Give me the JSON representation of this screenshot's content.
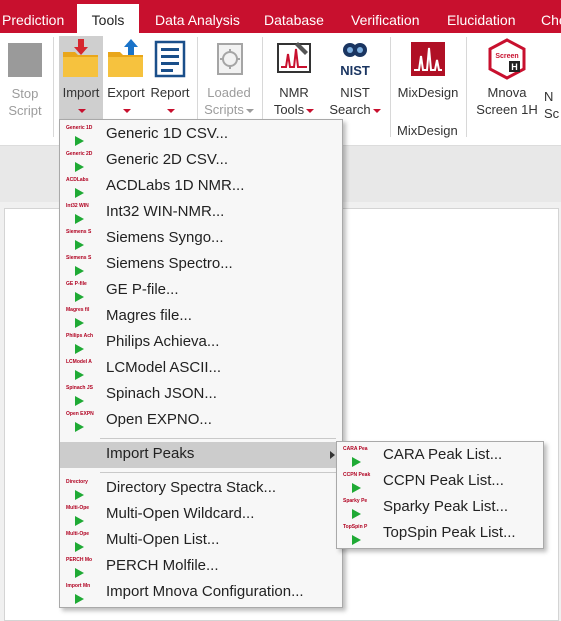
{
  "tabs": [
    {
      "label": "Prediction"
    },
    {
      "label": "Tools"
    },
    {
      "label": "Data Analysis"
    },
    {
      "label": "Database"
    },
    {
      "label": "Verification"
    },
    {
      "label": "Elucidation"
    },
    {
      "label": "Che"
    }
  ],
  "ribbon": {
    "stop_script": {
      "line1": "Stop",
      "line2": "Script"
    },
    "import": {
      "label": "Import"
    },
    "export": {
      "label": "Export"
    },
    "report": {
      "label": "Report"
    },
    "loaded_scripts": {
      "line1": "Loaded",
      "line2": "Scripts"
    },
    "nmr_tools": {
      "line1": "NMR",
      "line2": "Tools"
    },
    "nist_search": {
      "line1": "NIST",
      "line2": "Search"
    },
    "nist_logo_text": "NIST",
    "mixdesign": {
      "label": "MixDesign",
      "group_label": "MixDesign"
    },
    "mnova_screen": {
      "line1": "Mnova",
      "line2": "Screen 1H",
      "badge_text": "Screen",
      "badge_letter": "H"
    },
    "cut_off": {
      "line1": "N",
      "line2": "Sc"
    }
  },
  "import_menu": {
    "items": [
      {
        "label": "Generic 1D CSV...",
        "mini": "Generic 1D"
      },
      {
        "label": "Generic 2D CSV...",
        "mini": "Generic 2D"
      },
      {
        "label": "ACDLabs 1D NMR...",
        "mini": "ACDLabs"
      },
      {
        "label": "Int32 WIN-NMR...",
        "mini": "Int32 WIN"
      },
      {
        "label": "Siemens Syngo...",
        "mini": "Siemens S"
      },
      {
        "label": "Siemens Spectro...",
        "mini": "Siemens S"
      },
      {
        "label": "GE P-file...",
        "mini": "GE P-file"
      },
      {
        "label": "Magres file...",
        "mini": "Magres fil"
      },
      {
        "label": "Philips Achieva...",
        "mini": "Philips Ach"
      },
      {
        "label": "LCModel ASCII...",
        "mini": "LCModel A"
      },
      {
        "label": "Spinach JSON...",
        "mini": "Spinach JS"
      },
      {
        "label": "Open EXPNO...",
        "mini": "Open EXPN"
      }
    ],
    "import_peaks": {
      "label": "Import Peaks"
    },
    "items2": [
      {
        "label": "Directory Spectra Stack...",
        "mini": "Directory"
      },
      {
        "label": "Multi-Open Wildcard...",
        "mini": "Multi-Ope"
      },
      {
        "label": "Multi-Open List...",
        "mini": "Multi-Ope"
      },
      {
        "label": "PERCH Molfile...",
        "mini": "PERCH Mo"
      },
      {
        "label": "Import Mnova Configuration...",
        "mini": "Import Mn"
      }
    ]
  },
  "peaks_submenu": {
    "items": [
      {
        "label": "CARA Peak List...",
        "mini": "CARA Pea"
      },
      {
        "label": "CCPN Peak List...",
        "mini": "CCPN Peak"
      },
      {
        "label": "Sparky Peak List...",
        "mini": "Sparky Pe"
      },
      {
        "label": "TopSpin Peak List...",
        "mini": "TopSpin P"
      }
    ]
  },
  "colors": {
    "accent": "#c8102e",
    "play": "#1faa35",
    "highlight": "#cccccc"
  }
}
